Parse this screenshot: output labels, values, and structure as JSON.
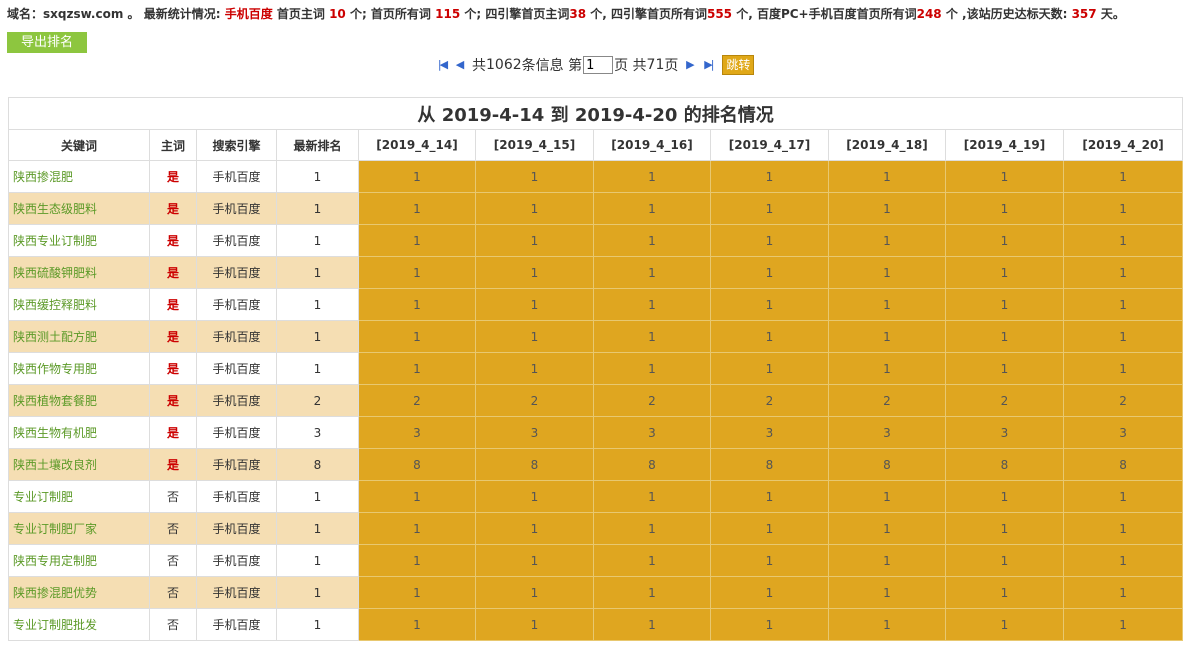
{
  "stats": {
    "domain_label": "域名：",
    "domain": "sxqzsw.com",
    "after_domain": " 。 最新统计情况: ",
    "engine": "手机百度",
    "t1": " 首页主词 ",
    "main_first_page": "10",
    "t2": " 个; 首页所有词 ",
    "all_first_page": "115",
    "t3": " 个; 四引擎首页主词",
    "four_main": "38",
    "t4": " 个, 四引擎首页所有词",
    "four_all": "555",
    "t5": " 个, 百度PC+手机百度首页所有词",
    "pc_mobile_all": "248",
    "t6": " 个 ,该站历史达标天数: ",
    "days": "357",
    "t7": " 天。"
  },
  "toolbar": {
    "export_label": "导出排名"
  },
  "pager": {
    "prefix": "共 ",
    "total_records": "1062",
    "records_suffix": " 条信息 第",
    "current_page": "1",
    "page_mid": "页 共 ",
    "total_pages": "71",
    "pages_suffix": " 页",
    "jump_label": "跳转"
  },
  "table": {
    "caption": "从 2019-4-14 到 2019-4-20 的排名情况",
    "headers": [
      "关键词",
      "主词",
      "搜索引擎",
      "最新排名"
    ],
    "dates": [
      "[2019_4_14]",
      "[2019_4_15]",
      "[2019_4_16]",
      "[2019_4_17]",
      "[2019_4_18]",
      "[2019_4_19]",
      "[2019_4_20]"
    ],
    "rows": [
      {
        "keyword": "陕西掺混肥",
        "main": "是",
        "engine": "手机百度",
        "latest": "1",
        "days": [
          "1",
          "1",
          "1",
          "1",
          "1",
          "1",
          "1"
        ]
      },
      {
        "keyword": "陕西生态级肥料",
        "main": "是",
        "engine": "手机百度",
        "latest": "1",
        "days": [
          "1",
          "1",
          "1",
          "1",
          "1",
          "1",
          "1"
        ]
      },
      {
        "keyword": "陕西专业订制肥",
        "main": "是",
        "engine": "手机百度",
        "latest": "1",
        "days": [
          "1",
          "1",
          "1",
          "1",
          "1",
          "1",
          "1"
        ]
      },
      {
        "keyword": "陕西硫酸钾肥料",
        "main": "是",
        "engine": "手机百度",
        "latest": "1",
        "days": [
          "1",
          "1",
          "1",
          "1",
          "1",
          "1",
          "1"
        ]
      },
      {
        "keyword": "陕西缓控释肥料",
        "main": "是",
        "engine": "手机百度",
        "latest": "1",
        "days": [
          "1",
          "1",
          "1",
          "1",
          "1",
          "1",
          "1"
        ]
      },
      {
        "keyword": "陕西测土配方肥",
        "main": "是",
        "engine": "手机百度",
        "latest": "1",
        "days": [
          "1",
          "1",
          "1",
          "1",
          "1",
          "1",
          "1"
        ]
      },
      {
        "keyword": "陕西作物专用肥",
        "main": "是",
        "engine": "手机百度",
        "latest": "1",
        "days": [
          "1",
          "1",
          "1",
          "1",
          "1",
          "1",
          "1"
        ]
      },
      {
        "keyword": "陕西植物套餐肥",
        "main": "是",
        "engine": "手机百度",
        "latest": "2",
        "days": [
          "2",
          "2",
          "2",
          "2",
          "2",
          "2",
          "2"
        ]
      },
      {
        "keyword": "陕西生物有机肥",
        "main": "是",
        "engine": "手机百度",
        "latest": "3",
        "days": [
          "3",
          "3",
          "3",
          "3",
          "3",
          "3",
          "3"
        ]
      },
      {
        "keyword": "陕西土壤改良剂",
        "main": "是",
        "engine": "手机百度",
        "latest": "8",
        "days": [
          "8",
          "8",
          "8",
          "8",
          "8",
          "8",
          "8"
        ]
      },
      {
        "keyword": "专业订制肥",
        "main": "否",
        "engine": "手机百度",
        "latest": "1",
        "days": [
          "1",
          "1",
          "1",
          "1",
          "1",
          "1",
          "1"
        ]
      },
      {
        "keyword": "专业订制肥厂家",
        "main": "否",
        "engine": "手机百度",
        "latest": "1",
        "days": [
          "1",
          "1",
          "1",
          "1",
          "1",
          "1",
          "1"
        ]
      },
      {
        "keyword": "陕西专用定制肥",
        "main": "否",
        "engine": "手机百度",
        "latest": "1",
        "days": [
          "1",
          "1",
          "1",
          "1",
          "1",
          "1",
          "1"
        ]
      },
      {
        "keyword": "陕西掺混肥优势",
        "main": "否",
        "engine": "手机百度",
        "latest": "1",
        "days": [
          "1",
          "1",
          "1",
          "1",
          "1",
          "1",
          "1"
        ]
      },
      {
        "keyword": "专业订制肥批发",
        "main": "否",
        "engine": "手机百度",
        "latest": "1",
        "days": [
          "1",
          "1",
          "1",
          "1",
          "1",
          "1",
          "1"
        ]
      }
    ]
  }
}
